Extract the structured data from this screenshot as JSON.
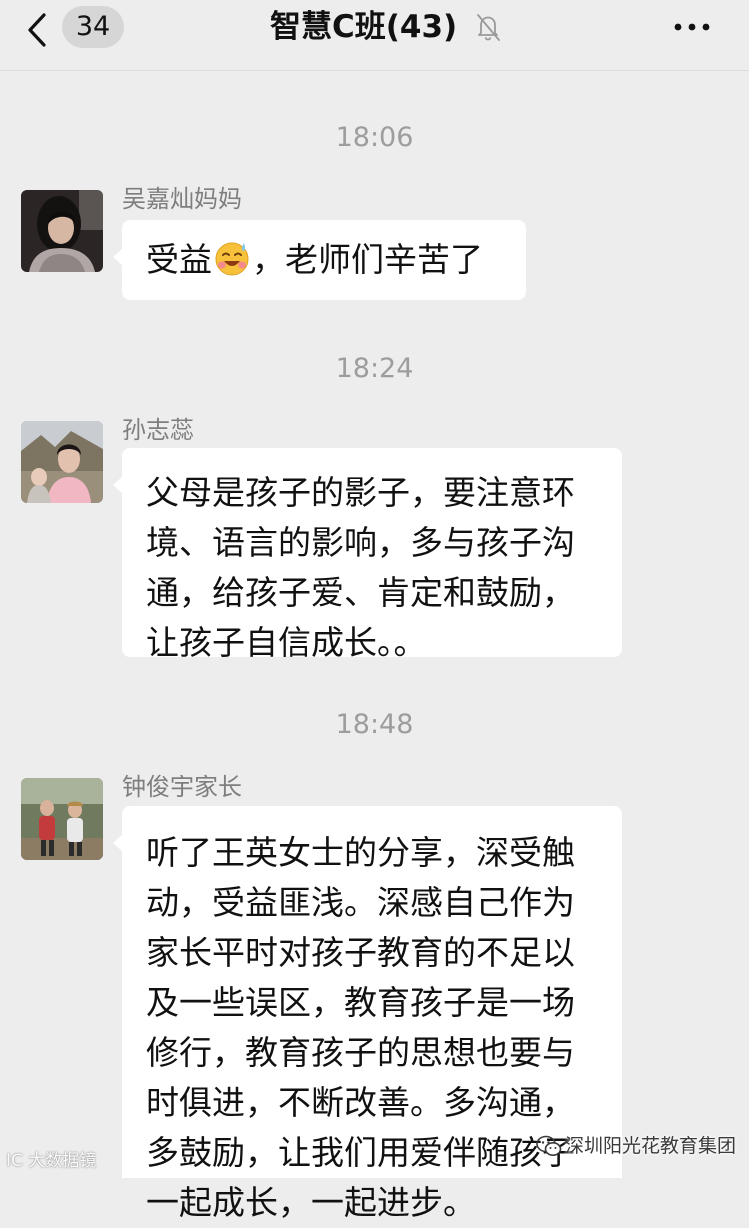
{
  "header": {
    "unread_count": "34",
    "title": "智慧C班(43)",
    "icons": {
      "back": "chevron-left-icon",
      "mute": "bell-slash-icon",
      "more": "more-dots-icon"
    }
  },
  "messages": [
    {
      "time": "18:06",
      "sender": "吴嘉灿妈妈",
      "text_before_emoji": "受益",
      "emoji": "grinning-sweat-face-emoji",
      "text_after_emoji": "，老师们辛苦了"
    },
    {
      "time": "18:24",
      "sender": "孙志蕊",
      "lines": [
        "父母是孩子的影子，要注意环",
        "境、语言的影响，多与孩子沟",
        "通，给孩子爱、肯定和鼓励，",
        "让孩子自信成长。。"
      ]
    },
    {
      "time": "18:48",
      "sender": "钟俊宇家长",
      "lines": [
        "听了王英女士的分享，深受触",
        "动，受益匪浅。深感自己作为",
        "家长平时对孩子教育的不足以",
        "及一些误区，教育孩子是一场",
        "修行，教育孩子的思想也要与",
        "时俱进，不断改善。多沟通，",
        "多鼓励，让我们用爱伴随孩子",
        "一起成长，一起进步。"
      ]
    }
  ],
  "watermarks": {
    "left": "IC 大数据镜",
    "right": "深圳阳光花教育集团"
  },
  "colors": {
    "background": "#ededed",
    "bubble": "#ffffff",
    "time_text": "#9d9d9d",
    "sender_text": "#7e7e7e"
  }
}
